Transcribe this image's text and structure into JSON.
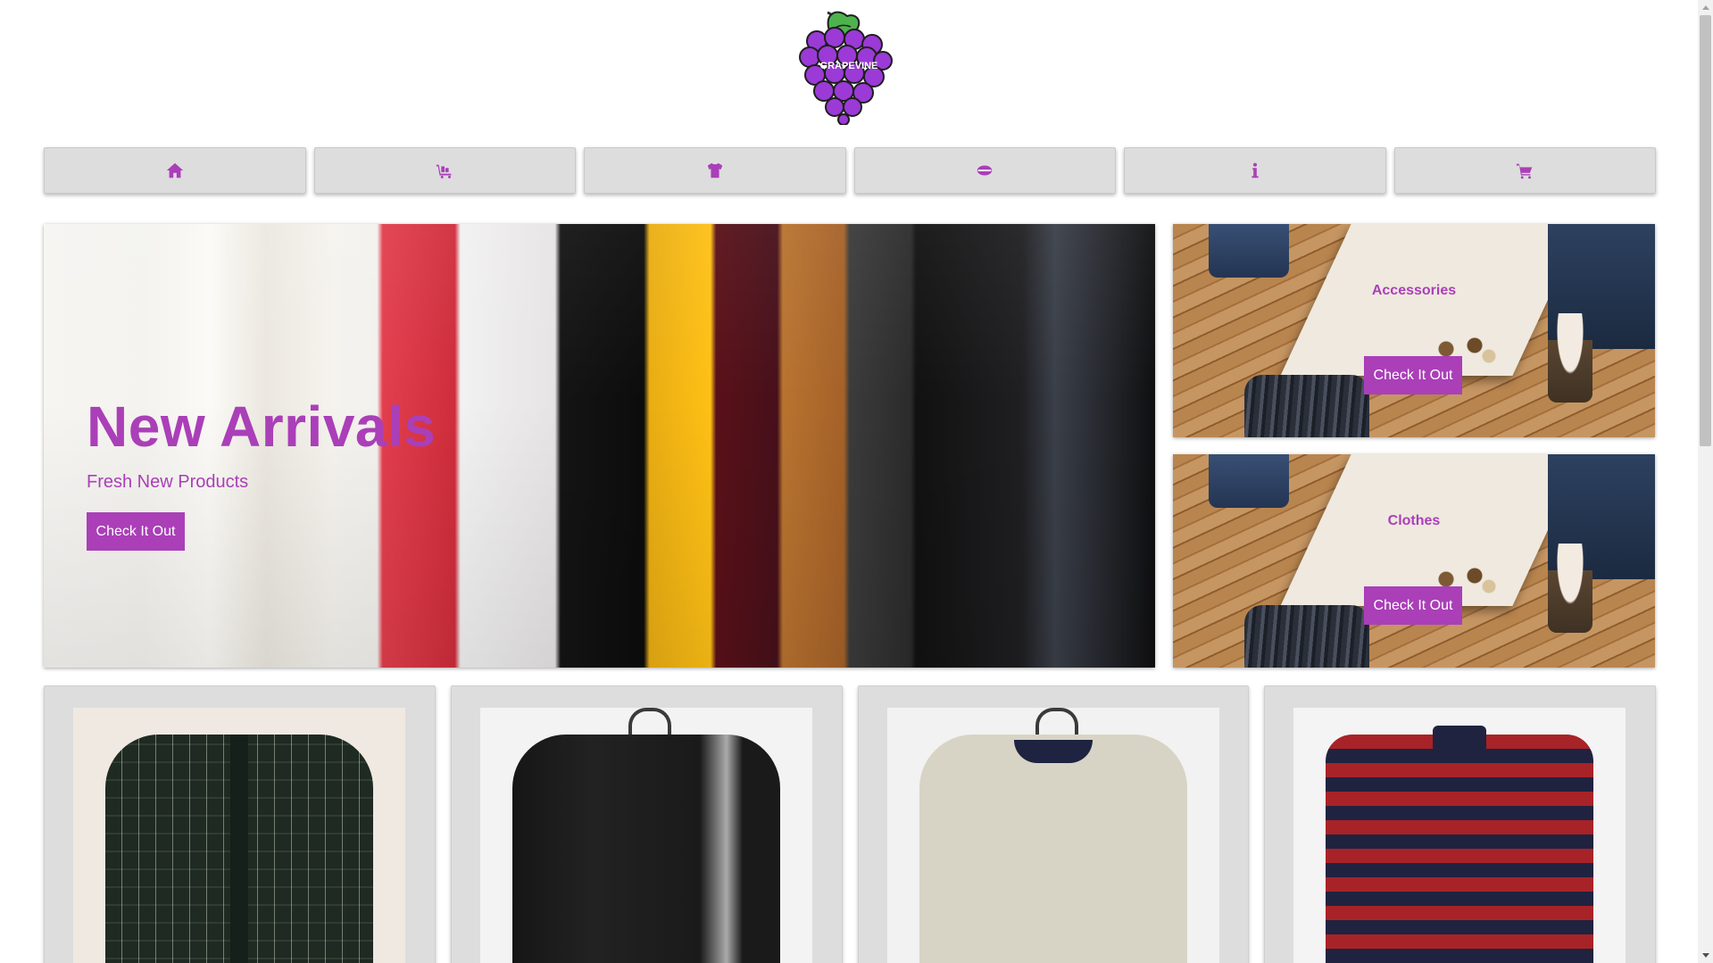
{
  "brand": {
    "name": "GRAPEVINE"
  },
  "nav": {
    "items": [
      {
        "icon": "home-icon"
      },
      {
        "icon": "shop-icon"
      },
      {
        "icon": "shirt-icon"
      },
      {
        "icon": "hat-icon"
      },
      {
        "icon": "info-icon"
      },
      {
        "icon": "cart-icon"
      }
    ]
  },
  "hero": {
    "title": "New Arrivals",
    "subtitle": "Fresh New Products",
    "button_label": "Check It Out"
  },
  "promos": [
    {
      "label": "Accessories",
      "button_label": "Check It Out"
    },
    {
      "label": "Clothes",
      "button_label": "Check It Out"
    }
  ],
  "colors": {
    "accent": "#aa3fb8",
    "nav_bg": "#dddddd",
    "grape": "#9b3ad6",
    "leaf": "#4db34d"
  },
  "products": [
    {
      "name": "plaid-shirt"
    },
    {
      "name": "black-windbreaker"
    },
    {
      "name": "cream-pullover"
    },
    {
      "name": "striped-polo"
    }
  ]
}
